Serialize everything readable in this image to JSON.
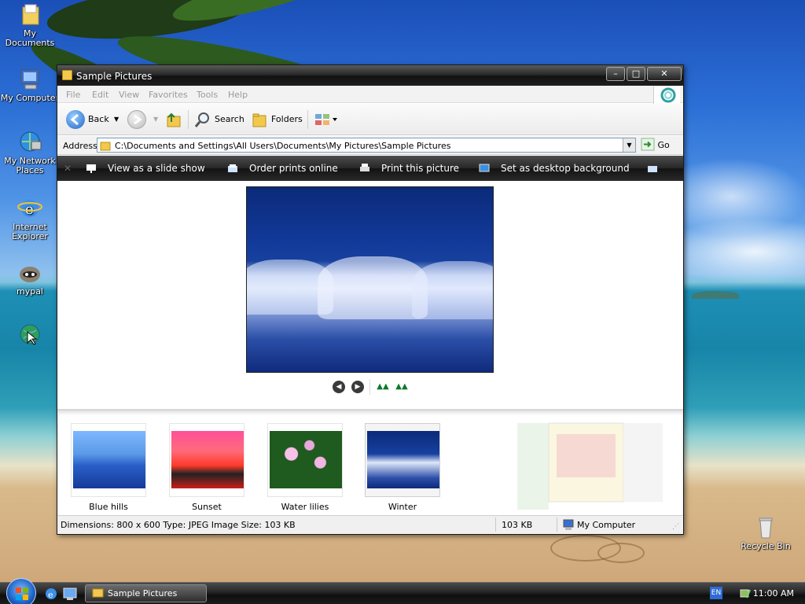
{
  "desktop": {
    "icons": [
      {
        "label": "My Documents",
        "icon": "folder-documents-icon"
      },
      {
        "label": "My Computer",
        "icon": "computer-icon"
      },
      {
        "label": "My Network Places",
        "icon": "network-icon"
      },
      {
        "label": "Internet Explorer",
        "icon": "ie-icon"
      },
      {
        "label": "mypal",
        "icon": "raccoon-icon"
      },
      {
        "label": "",
        "icon": "globe-icon"
      },
      {
        "label": "Recycle Bin",
        "icon": "recycle-bin-icon"
      }
    ]
  },
  "window": {
    "title": "Sample Pictures",
    "menu": [
      "File",
      "Edit",
      "View",
      "Favorites",
      "Tools",
      "Help"
    ],
    "toolbar": {
      "back": "Back",
      "search": "Search",
      "folders": "Folders"
    },
    "address": {
      "label": "Address",
      "path": "C:\\Documents and Settings\\All Users\\Documents\\My Pictures\\Sample Pictures",
      "go": "Go"
    },
    "tasks": [
      {
        "label": "View as a slide show",
        "icon": "slideshow-icon"
      },
      {
        "label": "Order prints online",
        "icon": "order-prints-icon"
      },
      {
        "label": "Print this picture",
        "icon": "printer-icon"
      },
      {
        "label": "Set as desktop background",
        "icon": "desktop-background-icon"
      }
    ],
    "thumbnails": [
      {
        "caption": "Blue hills"
      },
      {
        "caption": "Sunset"
      },
      {
        "caption": "Water lilies"
      },
      {
        "caption": "Winter"
      }
    ],
    "status": {
      "details": "Dimensions: 800 x 600 Type: JPEG Image Size: 103 KB",
      "size": "103 KB",
      "zone": "My Computer"
    }
  },
  "taskbar": {
    "task": "Sample Pictures",
    "language": "EN",
    "clock": "11:00 AM"
  },
  "colors": {
    "accent": "#1a5fc4",
    "title_bar": "#1f1f1f",
    "task_strip": "#262626"
  }
}
